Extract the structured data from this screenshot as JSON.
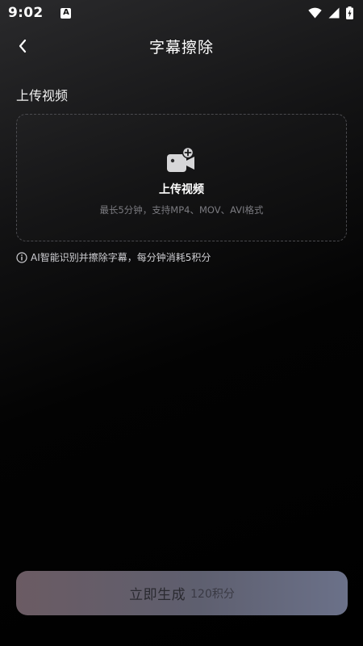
{
  "status_bar": {
    "time": "9:02",
    "app_indicator": "A",
    "icons": [
      "wifi-icon",
      "signal-icon",
      "battery-charging-icon"
    ]
  },
  "header": {
    "title": "字幕擦除",
    "back_icon": "chevron-left-icon"
  },
  "upload": {
    "section_title": "上传视频",
    "icon": "video-camera-plus-icon",
    "label": "上传视频",
    "hint": "最长5分钟，支持MP4、MOV、AVI格式"
  },
  "info": {
    "icon": "info-circle-icon",
    "text": "AI智能识别并擦除字幕，每分钟消耗5积分"
  },
  "action": {
    "label": "立即生成",
    "cost": "120积分"
  },
  "colors": {
    "background": "#000000",
    "button_gradient_start": "#6b5b63",
    "button_gradient_end": "#6b7189",
    "hint_text": "#7b7b80"
  }
}
